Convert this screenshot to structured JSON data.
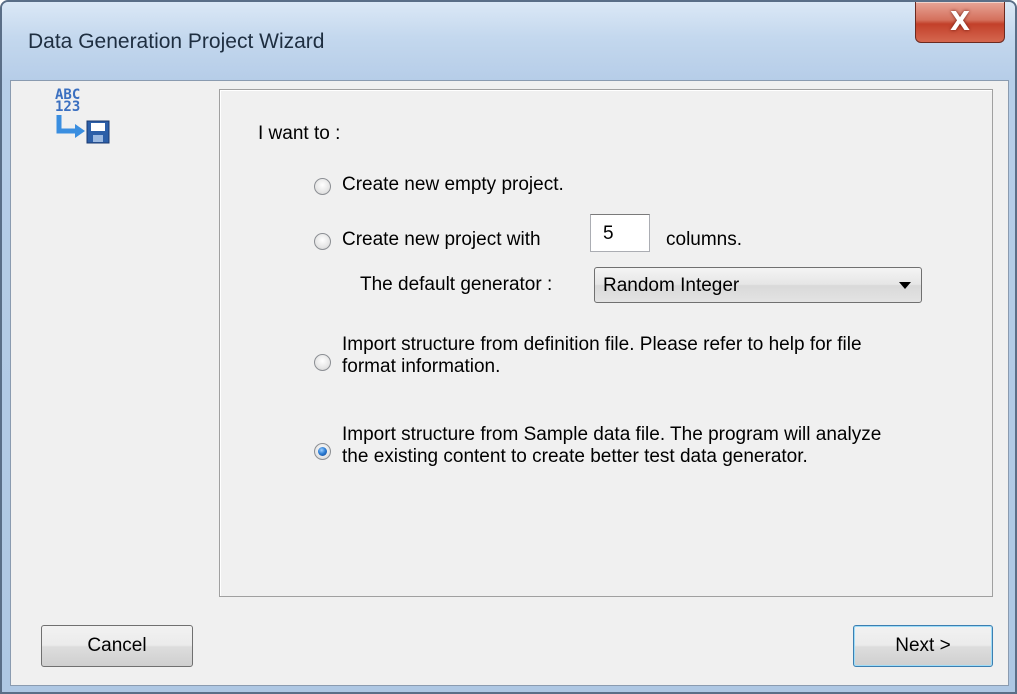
{
  "window": {
    "title": "Data Generation Project Wizard",
    "close_label": "X"
  },
  "icon": {
    "abc_text": "ABC",
    "num_text": "123"
  },
  "panel": {
    "heading": "I want to :",
    "options": [
      {
        "label": "Create new empty project.",
        "selected": false
      },
      {
        "label": "Create new project with",
        "suffix": "columns.",
        "selected": false
      },
      {
        "label_line1": "Import structure from definition file. Please refer to help for file",
        "label_line2": "format information.",
        "selected": false
      },
      {
        "label_line1": "Import structure from Sample data file. The program will analyze",
        "label_line2": "the existing content to create better test data generator.",
        "selected": true
      }
    ],
    "columns_value": "5",
    "default_generator_label": "The default generator :",
    "default_generator_value": "Random Integer"
  },
  "buttons": {
    "cancel": "Cancel",
    "next": "Next >"
  },
  "colors": {
    "accent": "#3c7fb1",
    "close": "#c2402a"
  }
}
